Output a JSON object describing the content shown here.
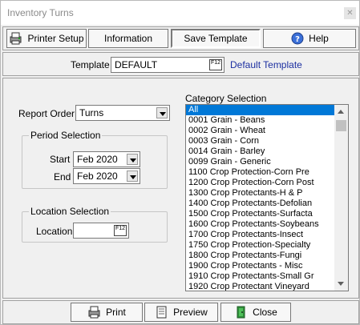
{
  "window": {
    "title": "Inventory Turns"
  },
  "toolbar": {
    "printer_setup": "Printer Setup",
    "information": "Information",
    "save_template": "Save Template",
    "help": "Help"
  },
  "template": {
    "label": "Template",
    "value": "DEFAULT",
    "f12": "F12",
    "description": "Default Template"
  },
  "report_order": {
    "label": "Report Order",
    "value": "Turns"
  },
  "period": {
    "legend": "Period Selection",
    "start_label": "Start",
    "start_value": "Feb 2020",
    "end_label": "End",
    "end_value": "Feb 2020"
  },
  "location": {
    "legend": "Location Selection",
    "label": "Location",
    "value": "",
    "f12": "F12"
  },
  "category": {
    "label": "Category Selection",
    "items": [
      "All",
      "0001 Grain - Beans",
      "0002 Grain - Wheat",
      "0003 Grain - Corn",
      "0014 Grain - Barley",
      "0099 Grain - Generic",
      "1100 Crop Protection-Corn Pre",
      "1200 Crop Protection-Corn Post",
      "1300 Crop Protectants-H & P",
      "1400 Crop Protectants-Defolian",
      "1500 Crop Protectants-Surfacta",
      "1600 Crop Protectants-Soybeans",
      "1700 Crop Protectants-Insect",
      "1750 Crop Protection-Specialty",
      "1800 Crop Protectants-Fungi",
      "1900 Crop Protectants - Misc",
      "1910 Crop Protectants-Small Gr",
      "1920 Crop Protectant Vineyard"
    ],
    "selected_index": 0
  },
  "bottom": {
    "print": "Print",
    "preview": "Preview",
    "close": "Close"
  },
  "colors": {
    "selection": "#0078d7",
    "link_blue": "#1c2fa0"
  }
}
